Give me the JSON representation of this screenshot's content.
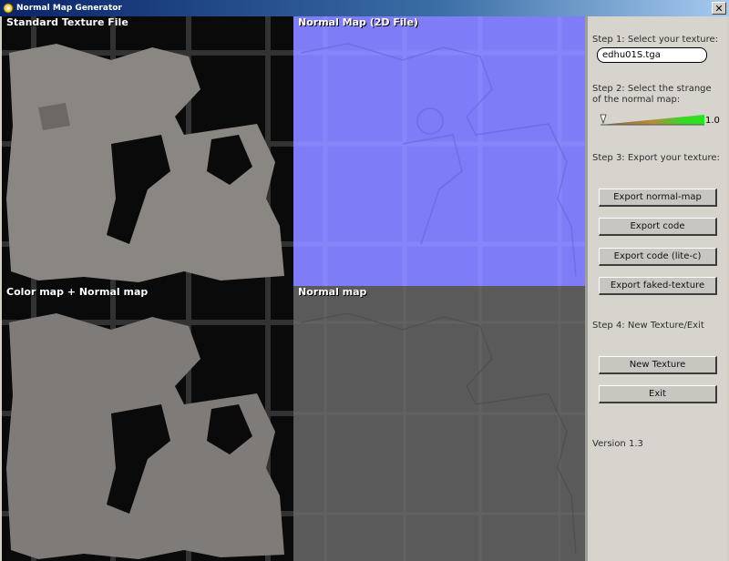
{
  "window": {
    "title": "Normal Map Generator",
    "close_glyph": "✕"
  },
  "panels": {
    "top_left": {
      "label": "Standard Texture File"
    },
    "top_right": {
      "label": "Normal Map (2D File)"
    },
    "bottom_left": {
      "label": "Color map + Normal map"
    },
    "bottom_right": {
      "label": "Normal map"
    }
  },
  "controls": {
    "step1": "Step 1: Select your texture:",
    "texture_file": "edhu01S.tga",
    "step2": "Step 2: Select the strange of the normal map:",
    "strength_value": "1.0",
    "strength_fraction": 1.0,
    "step3": "Step 3: Export your texture:",
    "buttons": {
      "export_normal": "Export normal-map",
      "export_code": "Export code",
      "export_code_lite": "Export code (lite-c)",
      "export_faked": "Export faked-texture",
      "new_texture": "New Texture",
      "exit": "Exit"
    },
    "step4": "Step 4: New Texture/Exit",
    "version": "Version 1.3"
  },
  "colors": {
    "normal_map_blue": "#7f7cf7",
    "slider_green": "#22e81a",
    "panel_bg": "#d6d4cd"
  },
  "icons": {
    "app": "app-icon",
    "close": "close-icon",
    "slider_handle": "slider-handle-icon"
  }
}
